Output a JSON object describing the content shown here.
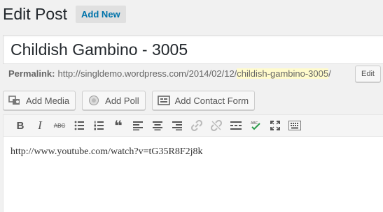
{
  "header": {
    "title": "Edit Post",
    "add_new": "Add New"
  },
  "post": {
    "title": "Childish Gambino - 3005"
  },
  "permalink": {
    "label": "Permalink:",
    "base": "http://singldemo.wordpress.com/2014/02/12/",
    "slug": "childish-gambino-3005",
    "trail": "/",
    "edit": "Edit"
  },
  "media_buttons": {
    "add_media": "Add Media",
    "add_poll": "Add Poll",
    "add_contact_form": "Add Contact Form"
  },
  "toolbar": {
    "bold": "B",
    "italic": "I",
    "strike": "ABC",
    "quote": "❝"
  },
  "editor": {
    "content": "http://www.youtube.com/watch?v=tG35R8F2j8k"
  },
  "icons": [
    "media-icon",
    "poll-icon",
    "contact-form-icon",
    "bold-icon",
    "italic-icon",
    "strikethrough-icon",
    "bullet-list-icon",
    "numbered-list-icon",
    "blockquote-icon",
    "align-left-icon",
    "align-center-icon",
    "align-right-icon",
    "link-icon",
    "unlink-icon",
    "read-more-icon",
    "spellcheck-icon",
    "fullscreen-icon",
    "kitchen-sink-icon"
  ]
}
